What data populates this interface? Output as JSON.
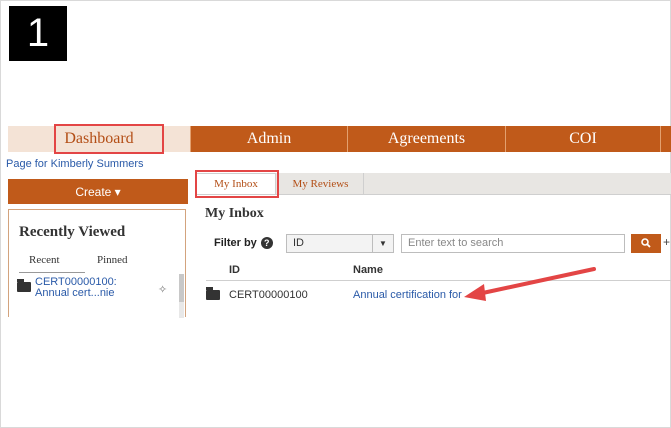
{
  "step": {
    "number": "1"
  },
  "nav": {
    "items": [
      {
        "label": "Dashboard",
        "active": true
      },
      {
        "label": "Admin"
      },
      {
        "label": "Agreements"
      },
      {
        "label": "COI"
      }
    ]
  },
  "page_link": "Page for Kimberly Summers",
  "create_button": {
    "label": "Create ▾"
  },
  "recently_viewed": {
    "title": "Recently Viewed",
    "tabs": [
      "Recent",
      "Pinned"
    ],
    "items": [
      {
        "label": "CERT00000100: Annual cert...nie"
      }
    ]
  },
  "content_tabs": [
    {
      "label": "My Inbox",
      "active": true
    },
    {
      "label": "My Reviews"
    }
  ],
  "inbox": {
    "title": "My Inbox",
    "filter_label": "Filter by",
    "filter_value": "ID",
    "search_placeholder": "Enter text to search",
    "search_icon": "search-icon",
    "columns": [
      "ID",
      "Name"
    ],
    "rows": [
      {
        "id": "CERT00000100",
        "name": "Annual certification for"
      }
    ]
  },
  "colors": {
    "brand": "#c05a1a",
    "highlight": "#e34545",
    "link": "#2a5aa8"
  }
}
